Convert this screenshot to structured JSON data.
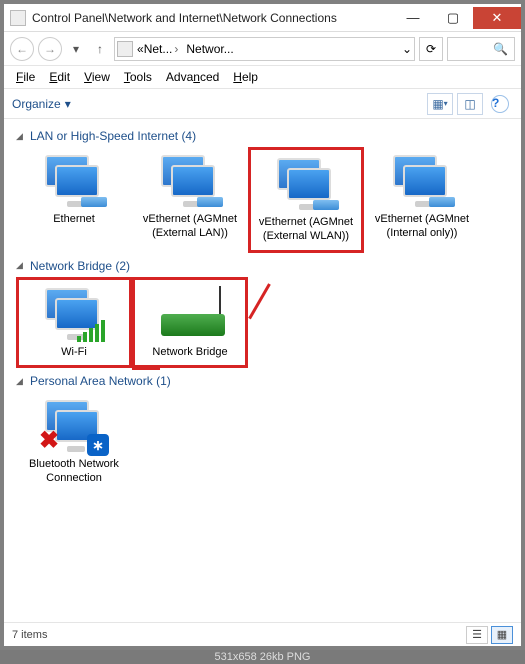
{
  "window": {
    "title": "Control Panel\\Network and Internet\\Network Connections"
  },
  "nav": {
    "crumb1": "Net...",
    "crumb2": "Networ..."
  },
  "menu": {
    "file": "File",
    "edit": "Edit",
    "view": "View",
    "tools": "Tools",
    "advanced": "Advanced",
    "help": "Help"
  },
  "toolbar": {
    "organize": "Organize"
  },
  "groups": [
    {
      "label": "LAN or High-Speed Internet",
      "count": "(4)"
    },
    {
      "label": "Network Bridge",
      "count": "(2)"
    },
    {
      "label": "Personal Area Network",
      "count": "(1)"
    }
  ],
  "items": {
    "g0": [
      {
        "name": "Ethernet"
      },
      {
        "name": "vEthernet (AGMnet (External LAN))"
      },
      {
        "name": "vEthernet (AGMnet (External WLAN))"
      },
      {
        "name": "vEthernet (AGMnet (Internal only))"
      }
    ],
    "g1": [
      {
        "name": "Wi-Fi"
      },
      {
        "name": "Network Bridge"
      }
    ],
    "g2": [
      {
        "name": "Bluetooth Network Connection"
      }
    ]
  },
  "status": {
    "count": "7 items"
  },
  "footer": "531x658   26kb   PNG"
}
